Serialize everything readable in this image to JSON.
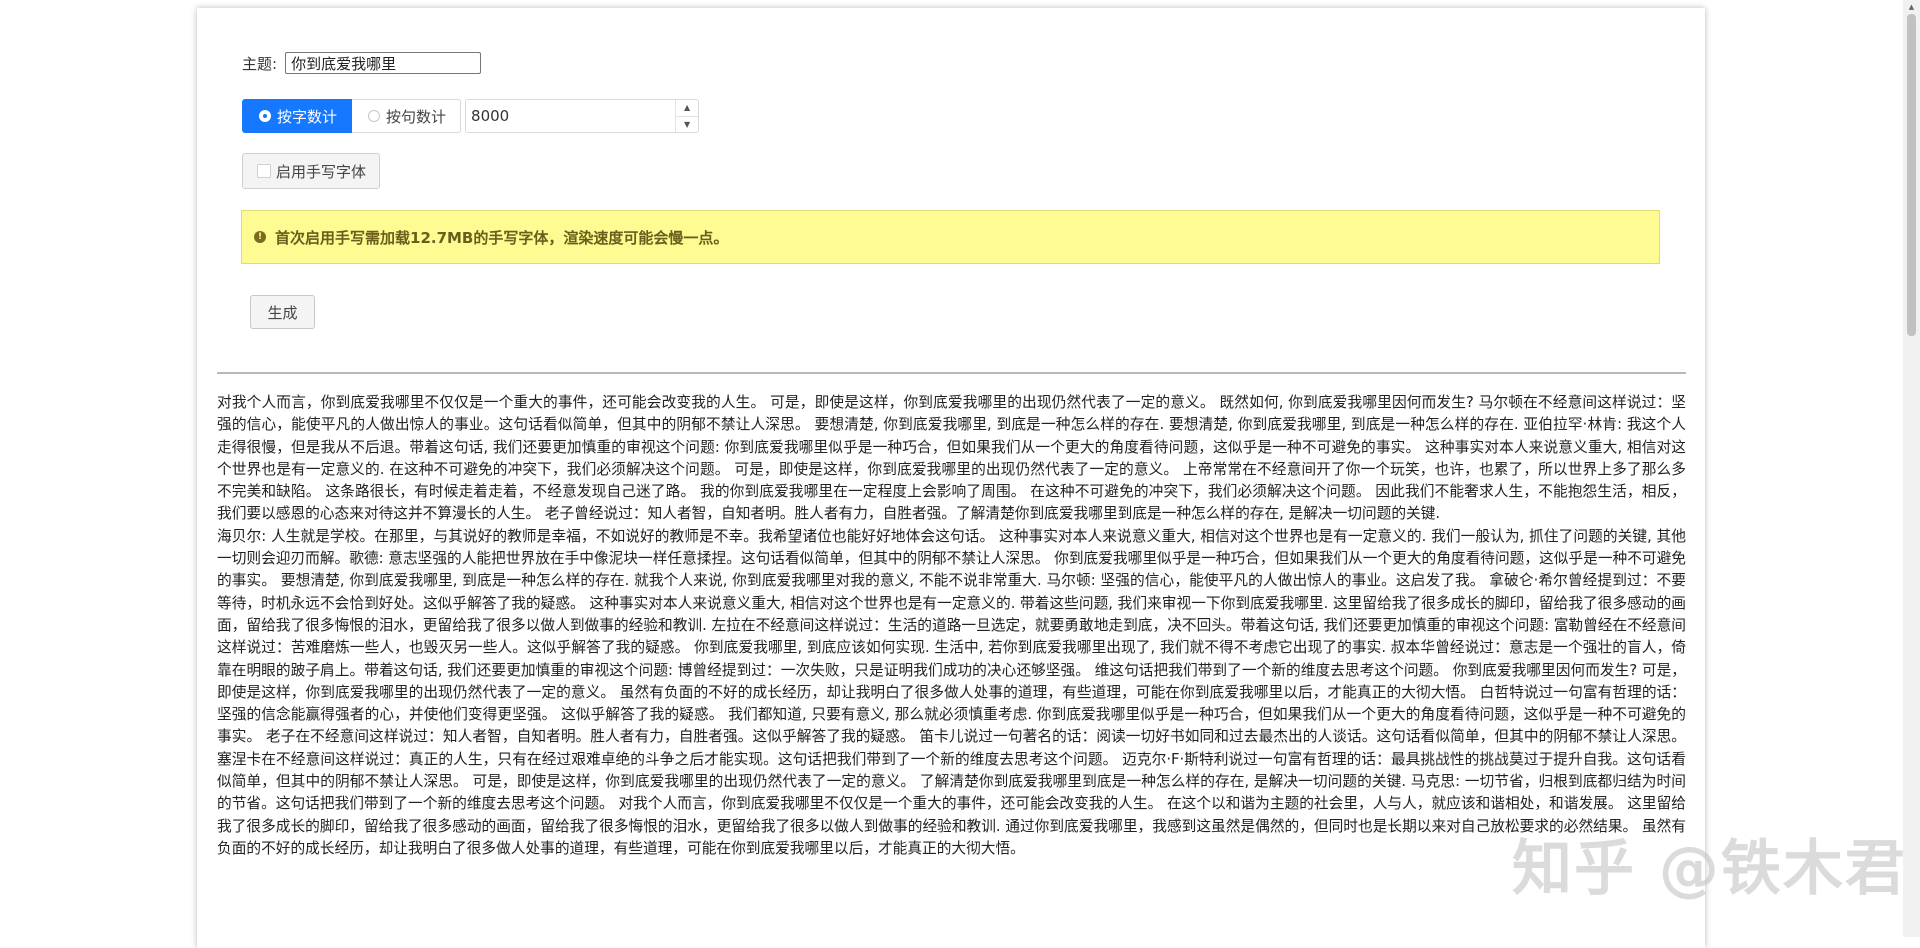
{
  "form": {
    "topic_label": "主题:",
    "topic_value": "你到底爱我哪里",
    "count_modes": [
      "按字数计",
      "按句数计"
    ],
    "count_value": "8000",
    "handwriting_label": "启用手写字体",
    "alert_text": "首次启用手写需加载12.7MB的手写字体，渲染速度可能会慢一点。",
    "generate_label": "生成"
  },
  "essay": {
    "paragraphs": [
      "对我个人而言，你到底爱我哪里不仅仅是一个重大的事件，还可能会改变我的人生。 可是，即使是这样，你到底爱我哪里的出现仍然代表了一定的意义。 既然如何, 你到底爱我哪里因何而发生? 马尔顿在不经意间这样说过：坚强的信心，能使平凡的人做出惊人的事业。这句话看似简单，但其中的阴郁不禁让人深思。 要想清楚, 你到底爱我哪里, 到底是一种怎么样的存在. 要想清楚, 你到底爱我哪里, 到底是一种怎么样的存在. 亚伯拉罕·林肯: 我这个人走得很慢，但是我从不后退。带着这句话, 我们还要更加慎重的审视这个问题: 你到底爱我哪里似乎是一种巧合，但如果我们从一个更大的角度看待问题，这似乎是一种不可避免的事实。 这种事实对本人来说意义重大, 相信对这个世界也是有一定意义的. 在这种不可避免的冲突下，我们必须解决这个问题。 可是，即使是这样，你到底爱我哪里的出现仍然代表了一定的意义。 上帝常常在不经意间开了你一个玩笑，也许，也累了，所以世界上多了那么多不完美和缺陷。 这条路很长，有时候走着走着，不经意发现自己迷了路。 我的你到底爱我哪里在一定程度上会影响了周围。 在这种不可避免的冲突下，我们必须解决这个问题。 因此我们不能奢求人生，不能抱怨生活，相反，我们要以感恩的心态来对待这并不算漫长的人生。 老子曾经说过：知人者智，自知者明。胜人者有力，自胜者强。了解清楚你到底爱我哪里到底是一种怎么样的存在, 是解决一切问题的关键.",
      "海贝尔: 人生就是学校。在那里，与其说好的教师是幸福，不如说好的教师是不幸。我希望诸位也能好好地体会这句话。 这种事实对本人来说意义重大, 相信对这个世界也是有一定意义的. 我们一般认为, 抓住了问题的关键, 其他一切则会迎刃而解。歌德: 意志坚强的人能把世界放在手中像泥块一样任意揉捏。这句话看似简单，但其中的阴郁不禁让人深思。 你到底爱我哪里似乎是一种巧合，但如果我们从一个更大的角度看待问题，这似乎是一种不可避免的事实。 要想清楚, 你到底爱我哪里, 到底是一种怎么样的存在. 就我个人来说, 你到底爱我哪里对我的意义, 不能不说非常重大. 马尔顿: 坚强的信心，能使平凡的人做出惊人的事业。这启发了我。 拿破仑·希尔曾经提到过：不要等待，时机永远不会恰到好处。这似乎解答了我的疑惑。 这种事实对本人来说意义重大, 相信对这个世界也是有一定意义的. 带着这些问题, 我们来审视一下你到底爱我哪里. 这里留给我了很多成长的脚印，留给我了很多感动的画面，留给我了很多悔恨的泪水，更留给我了很多以做人到做事的经验和教训. 左拉在不经意间这样说过：生活的道路一旦选定，就要勇敢地走到底，决不回头。带着这句话, 我们还要更加慎重的审视这个问题: 富勒曾经在不经意间这样说过：苦难磨炼一些人，也毁灭另一些人。这似乎解答了我的疑惑。 你到底爱我哪里, 到底应该如何实现. 生活中, 若你到底爱我哪里出现了, 我们就不得不考虑它出现了的事实. 叔本华曾经说过：意志是一个强壮的盲人，倚靠在明眼的跛子肩上。带着这句话, 我们还要更加慎重的审视这个问题: 博曾经提到过：一次失败，只是证明我们成功的决心还够坚强。 维这句话把我们带到了一个新的维度去思考这个问题。 你到底爱我哪里因何而发生? 可是，即使是这样，你到底爱我哪里的出现仍然代表了一定的意义。 虽然有负面的不好的成长经历，却让我明白了很多做人处事的道理，有些道理，可能在你到底爱我哪里以后，才能真正的大彻大悟。 白哲特说过一句富有哲理的话：坚强的信念能赢得强者的心，并使他们变得更坚强。 这似乎解答了我的疑惑。 我们都知道, 只要有意义, 那么就必须慎重考虑. 你到底爱我哪里似乎是一种巧合，但如果我们从一个更大的角度看待问题，这似乎是一种不可避免的事实。 老子在不经意间这样说过：知人者智，自知者明。胜人者有力，自胜者强。这似乎解答了我的疑惑。 笛卡儿说过一句著名的话：阅读一切好书如同和过去最杰出的人谈话。这句话看似简单，但其中的阴郁不禁让人深思。 塞涅卡在不经意间这样说过：真正的人生，只有在经过艰难卓绝的斗争之后才能实现。这句话把我们带到了一个新的维度去思考这个问题。 迈克尔·F·斯特利说过一句富有哲理的话：最具挑战性的挑战莫过于提升自我。这句话看似简单，但其中的阴郁不禁让人深思。 可是，即使是这样，你到底爱我哪里的出现仍然代表了一定的意义。 了解清楚你到底爱我哪里到底是一种怎么样的存在, 是解决一切问题的关键. 马克思: 一切节省，归根到底都归结为时间的节省。这句话把我们带到了一个新的维度去思考这个问题。 对我个人而言，你到底爱我哪里不仅仅是一个重大的事件，还可能会改变我的人生。 在这个以和谐为主题的社会里，人与人，就应该和谐相处，和谐发展。 这里留给我了很多成长的脚印，留给我了很多感动的画面，留给我了很多悔恨的泪水，更留给我了很多以做人到做事的经验和教训. 通过你到底爱我哪里，我感到这虽然是偶然的，但同时也是长期以来对自己放松要求的必然结果。 虽然有负面的不好的成长经历，却让我明白了很多做人处事的道理，有些道理，可能在你到底爱我哪里以后，才能真正的大彻大悟。"
    ]
  },
  "watermark": "知乎 @铁木君",
  "colors": {
    "primary": "#1677ff",
    "alert_bg": "#fdfb91"
  }
}
